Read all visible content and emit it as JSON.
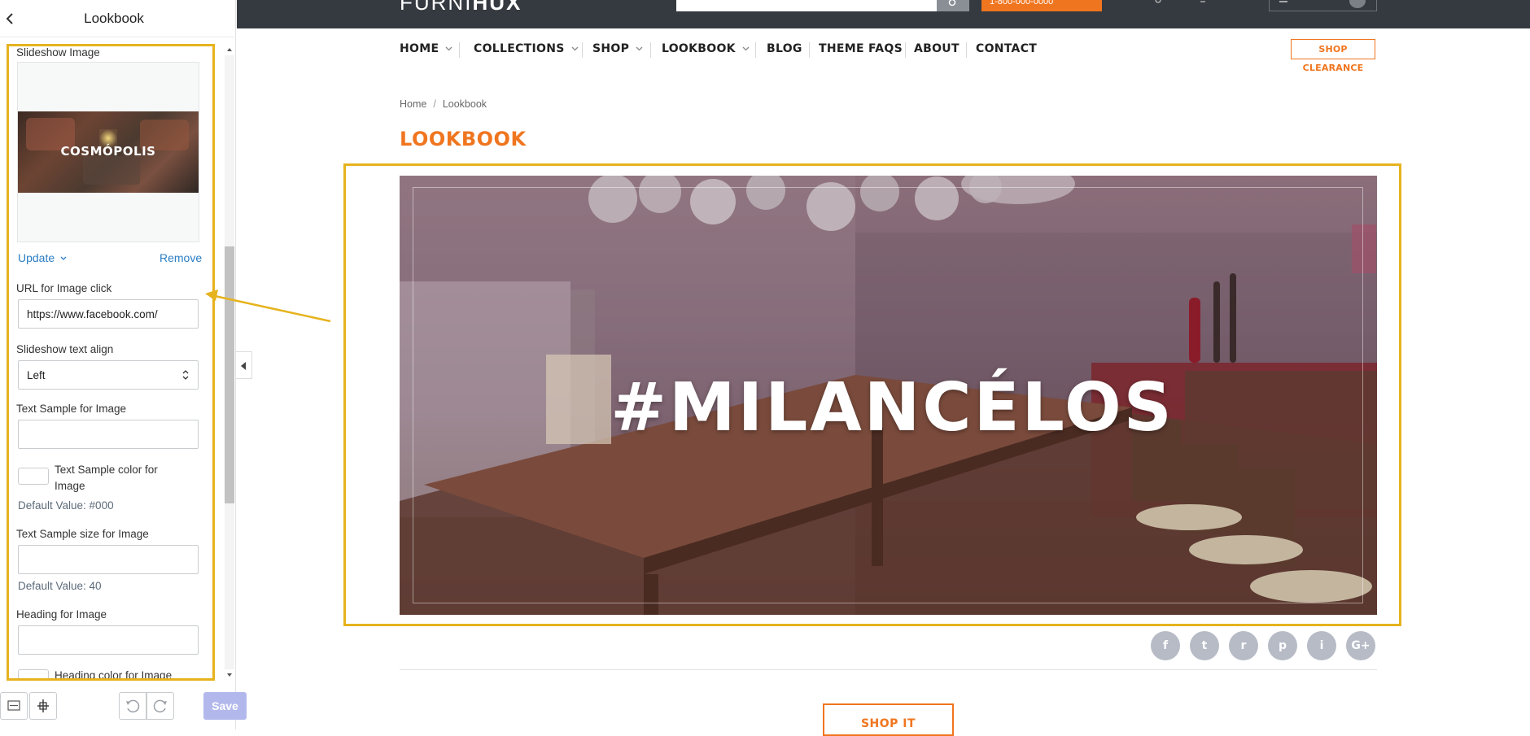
{
  "editor": {
    "title": "Lookbook",
    "fields": {
      "slideshow_image_label": "Slideshow Image",
      "thumbnail_caption": "COSMÓPOLIS",
      "update_label": "Update",
      "remove_label": "Remove",
      "url_label": "URL for Image click",
      "url_value": "https://www.facebook.com/",
      "text_align_label": "Slideshow text align",
      "text_align_value": "Left",
      "text_sample_label": "Text Sample for Image",
      "text_sample_value": "",
      "text_color_label": "Text Sample color for Image",
      "text_color_default": "Default Value: #000",
      "text_size_label": "Text Sample size for Image",
      "text_size_value": "",
      "text_size_default": "Default Value: 40",
      "heading_label": "Heading for Image",
      "heading_value": "",
      "heading_color_label": "Heading color for Image"
    },
    "footer": {
      "save_label": "Save"
    }
  },
  "store": {
    "logo_light": "FURNI",
    "logo_bold": "HUX",
    "phone": "1-800-000-0000",
    "nav": [
      {
        "label": "HOME"
      },
      {
        "label": "COLLECTIONS"
      },
      {
        "label": "SHOP"
      },
      {
        "label": "LOOKBOOK"
      },
      {
        "label": "BLOG"
      },
      {
        "label": "THEME FAQS"
      },
      {
        "label": "ABOUT"
      },
      {
        "label": "CONTACT"
      }
    ],
    "clearance_label": "SHOP CLEARANCE",
    "breadcrumb": {
      "home": "Home",
      "separator": "/",
      "current": "Lookbook"
    },
    "page_title": "LOOKBOOK",
    "hero_title": "#MILANCÉLOS",
    "social_glyphs": {
      "facebook": "f",
      "twitter": "t",
      "rss": "r",
      "pinterest": "p",
      "instagram": "i",
      "google_plus": "G+"
    },
    "shop_it_label": "SHOP IT"
  },
  "colors": {
    "accent_orange": "#f0751f",
    "highlight_yellow": "#e6b31e",
    "link_blue": "#2b7ec4",
    "topbar_dark": "#353a40",
    "save_disabled": "#b3b8ec"
  }
}
